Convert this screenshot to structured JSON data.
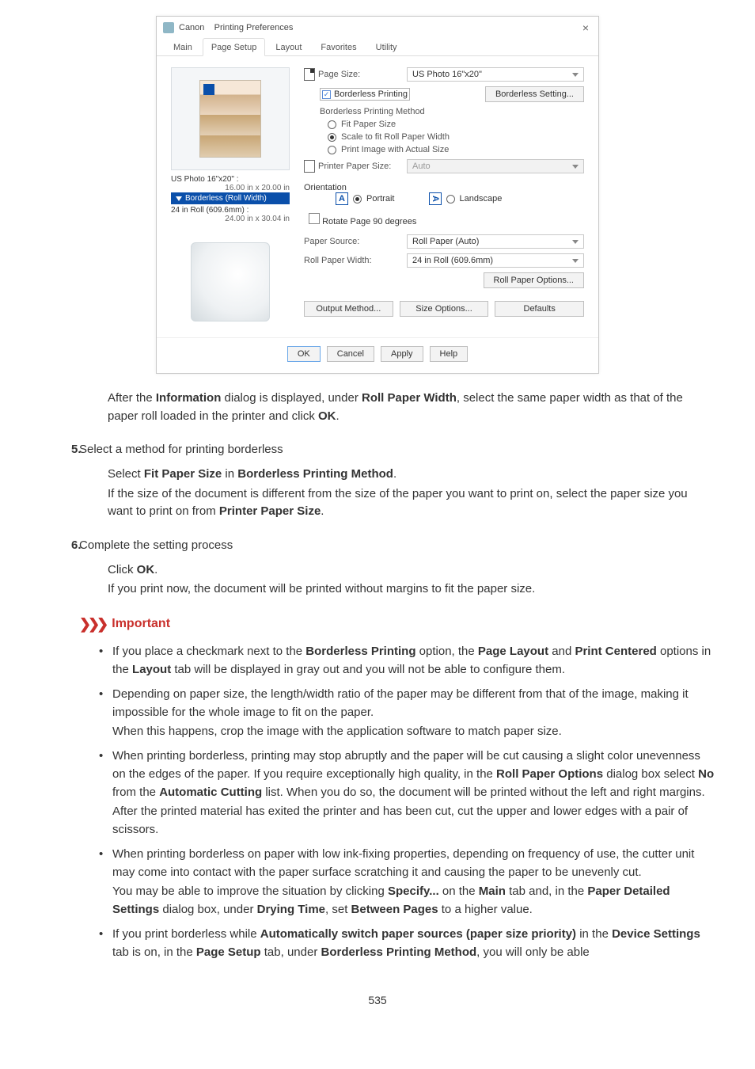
{
  "dialog": {
    "title_prefix": "Canon",
    "title_suffix": "Printing Preferences",
    "close_glyph": "×",
    "tabs": [
      "Main",
      "Page Setup",
      "Layout",
      "Favorites",
      "Utility"
    ],
    "active_tab_index": 1,
    "left": {
      "us_photo_label": "US Photo 16\"x20\" :",
      "us_photo_dim": "16.00 in x 20.00 in",
      "borderless_roll_width": "Borderless (Roll Width)",
      "roll_label": "24 in Roll (609.6mm) :",
      "roll_dim": "24.00 in x 30.04 in"
    },
    "right": {
      "page_size_label": "Page Size:",
      "page_size_value": "US Photo 16\"x20\"",
      "borderless_printing_cb": "Borderless Printing",
      "borderless_setting_btn": "Borderless Setting...",
      "borderless_method_label": "Borderless Printing Method",
      "fit_paper_size": "Fit Paper Size",
      "scale_fit_roll": "Scale to fit Roll Paper Width",
      "print_actual": "Print Image with Actual Size",
      "printer_paper_size_label": "Printer Paper Size:",
      "printer_paper_size_value": "Auto",
      "orientation_label": "Orientation",
      "portrait": "Portrait",
      "landscape": "Landscape",
      "rotate90": "Rotate Page 90 degrees",
      "paper_source_label": "Paper Source:",
      "paper_source_value": "Roll Paper (Auto)",
      "roll_paper_width_label": "Roll Paper Width:",
      "roll_paper_width_value": "24 in Roll (609.6mm)",
      "roll_options_btn": "Roll Paper Options...",
      "output_method_btn": "Output Method...",
      "size_options_btn": "Size Options...",
      "defaults_btn": "Defaults"
    },
    "buttons": {
      "ok": "OK",
      "cancel": "Cancel",
      "apply": "Apply",
      "help": "Help"
    }
  },
  "body": {
    "after_info_1": "After the ",
    "after_info_bold1": "Information",
    "after_info_2": " dialog is displayed, under ",
    "after_info_bold2": "Roll Paper Width",
    "after_info_3": ", select the same paper width as that of the paper roll loaded in the printer and click ",
    "after_info_bold3": "OK",
    "after_info_4": ".",
    "step5_num": "5.",
    "step5_head": "Select a method for printing borderless",
    "step5_p_1": "Select ",
    "step5_p_b1": "Fit Paper Size",
    "step5_p_2": " in ",
    "step5_p_b2": "Borderless Printing Method",
    "step5_p_3": ".",
    "step5_p2_1": "If the size of the document is different from the size of the paper you want to print on, select the paper size you want to print on from ",
    "step5_p2_b1": "Printer Paper Size",
    "step5_p2_2": ".",
    "step6_num": "6.",
    "step6_head": "Complete the setting process",
    "step6_p1_1": "Click ",
    "step6_p1_b1": "OK",
    "step6_p1_2": ".",
    "step6_p2": "If you print now, the document will be printed without margins to fit the paper size.",
    "important_label": "Important",
    "imp1_1": "If you place a checkmark next to the ",
    "imp1_b1": "Borderless Printing",
    "imp1_2": " option, the ",
    "imp1_b2": "Page Layout",
    "imp1_3": " and ",
    "imp1_b3": "Print Centered",
    "imp1_4": " options in the ",
    "imp1_b4": "Layout",
    "imp1_5": " tab will be displayed in gray out and you will not be able to configure them.",
    "imp2_1": "Depending on paper size, the length/width ratio of the paper may be different from that of the image, making it impossible for the whole image to fit on the paper.",
    "imp2_2": "When this happens, crop the image with the application software to match paper size.",
    "imp3_1": "When printing borderless, printing may stop abruptly and the paper will be cut causing a slight color unevenness on the edges of the paper. If you require exceptionally high quality, in the ",
    "imp3_b1": "Roll Paper Options",
    "imp3_2": " dialog box select ",
    "imp3_b2": "No",
    "imp3_3": " from the ",
    "imp3_b3": "Automatic Cutting",
    "imp3_4": " list. When you do so, the document will be printed without the left and right margins. After the printed material has exited the printer and has been cut, cut the upper and lower edges with a pair of scissors.",
    "imp4_1": "When printing borderless on paper with low ink-fixing properties, depending on frequency of use, the cutter unit may come into contact with the paper surface scratching it and causing the paper to be unevenly cut.",
    "imp4_2a": "You may be able to improve the situation by clicking ",
    "imp4_b1": "Specify...",
    "imp4_2b": " on the ",
    "imp4_b2": "Main",
    "imp4_2c": " tab and, in the ",
    "imp4_b3": "Paper Detailed Settings",
    "imp4_2d": " dialog box, under ",
    "imp4_b4": "Drying Time",
    "imp4_2e": ", set ",
    "imp4_b5": "Between Pages",
    "imp4_2f": " to a higher value.",
    "imp5_1": "If you print borderless while ",
    "imp5_b1": "Automatically switch paper sources (paper size priority)",
    "imp5_2": " in the ",
    "imp5_b2": "Device Settings",
    "imp5_3": " tab is on, in the ",
    "imp5_b3": "Page Setup",
    "imp5_4": " tab, under ",
    "imp5_b4": "Borderless Printing Method",
    "imp5_5": ", you will only be able",
    "page_number": "535"
  }
}
